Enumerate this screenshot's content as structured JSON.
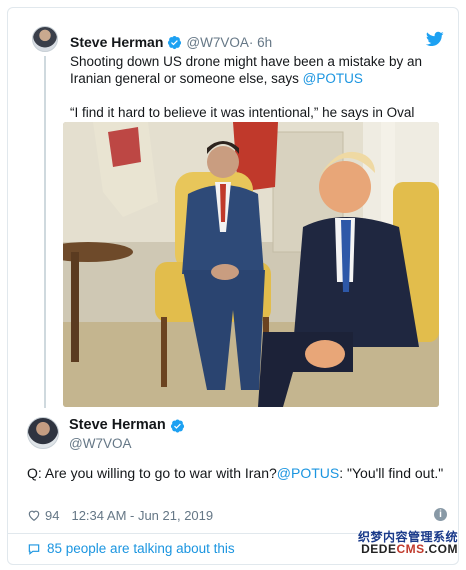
{
  "quoted": {
    "author_name": "Steve Herman",
    "handle": "@W7VOA",
    "time": " · 6h",
    "text_before": "Shooting down US drone might have been a mistake by an Iranian general or someone else, says ",
    "mention": "@POTUS",
    "quote_line": "“I find it hard to believe it was intentional,” he says in Oval Office."
  },
  "main": {
    "author_name": "Steve Herman",
    "handle": "@W7VOA",
    "text_before": "Q: Are you willing to go to war with Iran?",
    "mention": "@POTUS",
    "text_after": ": \"You'll find out.\"",
    "likes": "94",
    "timestamp": "12:34 AM - Jun 21, 2019",
    "talking": "85 people are talking about this"
  },
  "watermark": {
    "line1": "织梦内容管理系统",
    "line2_a": "DEDE",
    "line2_b": "CMS",
    "line2_c": ".COM"
  },
  "colors": {
    "link": "#1b95e0",
    "secondary": "#657786",
    "border": "#e1e8ed"
  },
  "icons": [
    "verified-icon",
    "twitter-bird-icon",
    "heart-icon",
    "info-icon",
    "speech-bubble-icon"
  ]
}
